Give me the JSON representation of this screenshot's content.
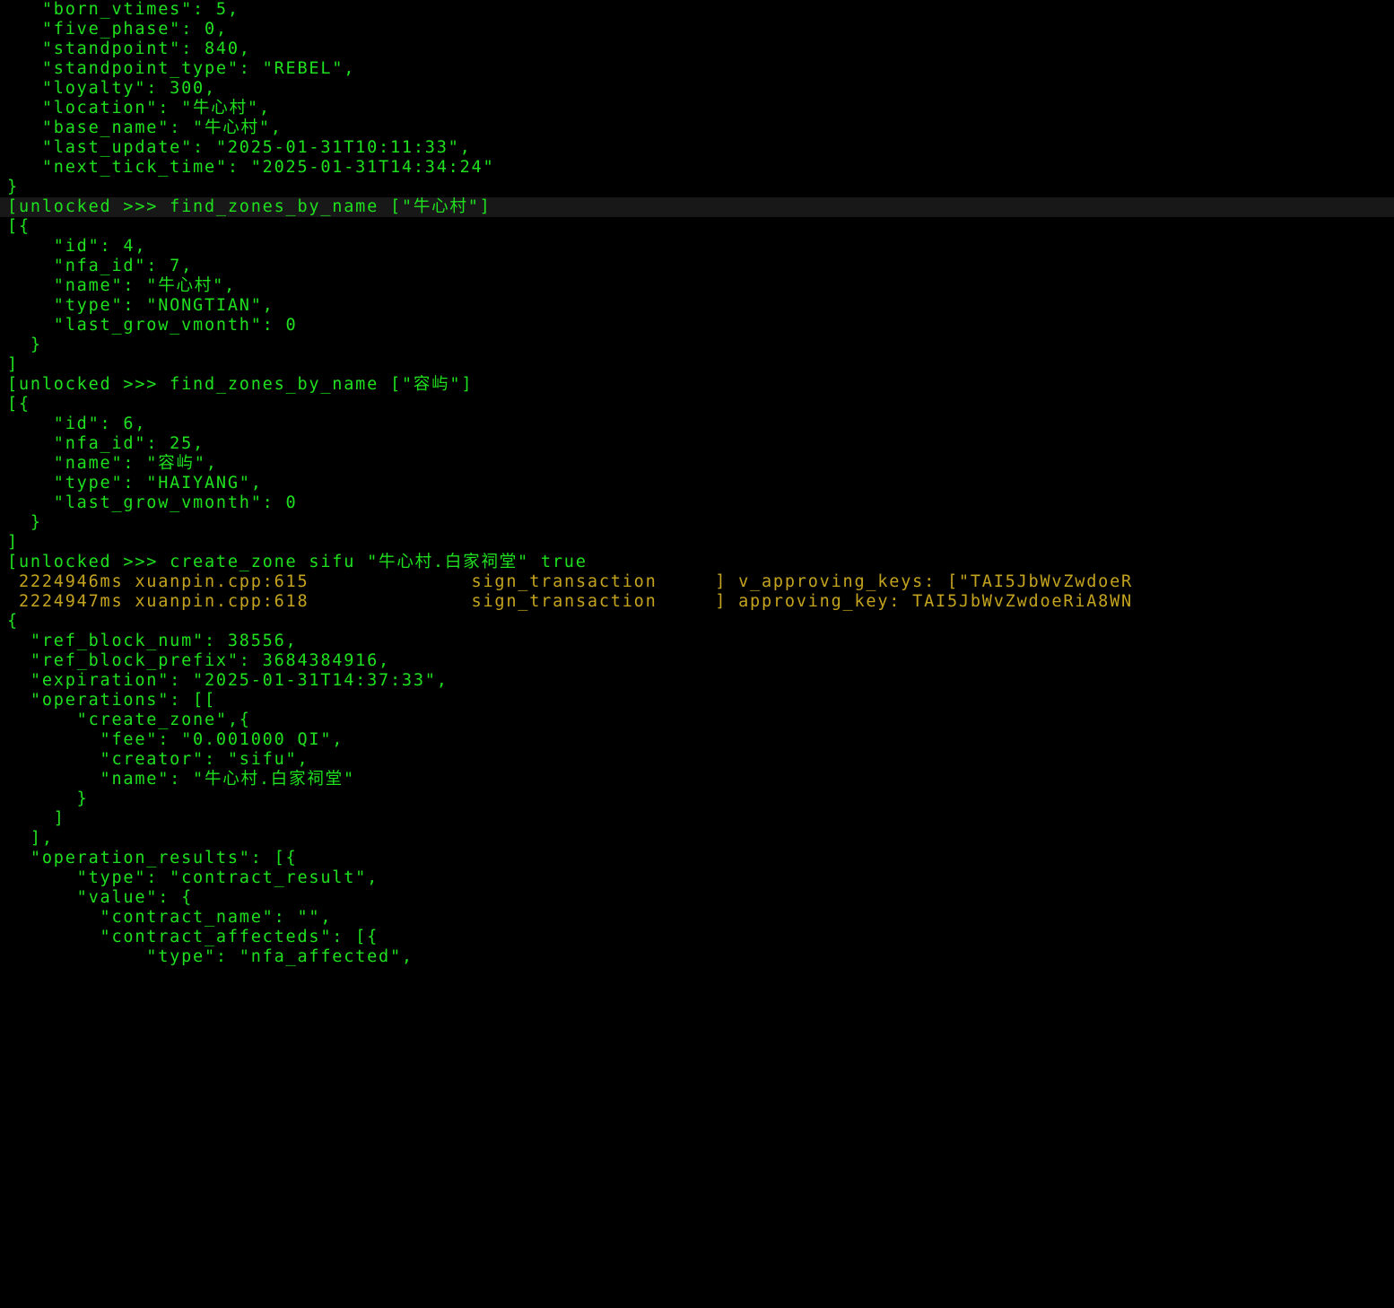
{
  "lines": [
    {
      "cls": "green",
      "text": "   \"born_vtimes\": 5,"
    },
    {
      "cls": "green",
      "text": "   \"five_phase\": 0,"
    },
    {
      "cls": "green",
      "text": "   \"standpoint\": 840,"
    },
    {
      "cls": "green",
      "text": "   \"standpoint_type\": \"REBEL\","
    },
    {
      "cls": "green",
      "text": "   \"loyalty\": 300,"
    },
    {
      "cls": "green",
      "text": "   \"location\": \"牛心村\","
    },
    {
      "cls": "green",
      "text": "   \"base_name\": \"牛心村\","
    },
    {
      "cls": "green",
      "text": "   \"last_update\": \"2025-01-31T10:11:33\","
    },
    {
      "cls": "green",
      "text": "   \"next_tick_time\": \"2025-01-31T14:34:24\""
    },
    {
      "cls": "green",
      "text": "}"
    },
    {
      "cls": "green hl",
      "text": "[unlocked >>> find_zones_by_name [\"牛心村\"]"
    },
    {
      "cls": "green",
      "text": "[{"
    },
    {
      "cls": "green",
      "text": "    \"id\": 4,"
    },
    {
      "cls": "green",
      "text": "    \"nfa_id\": 7,"
    },
    {
      "cls": "green",
      "text": "    \"name\": \"牛心村\","
    },
    {
      "cls": "green",
      "text": "    \"type\": \"NONGTIAN\","
    },
    {
      "cls": "green",
      "text": "    \"last_grow_vmonth\": 0"
    },
    {
      "cls": "green",
      "text": "  }"
    },
    {
      "cls": "green",
      "text": "]"
    },
    {
      "cls": "green",
      "text": "[unlocked >>> find_zones_by_name [\"容屿\"]"
    },
    {
      "cls": "green",
      "text": "[{"
    },
    {
      "cls": "green",
      "text": "    \"id\": 6,"
    },
    {
      "cls": "green",
      "text": "    \"nfa_id\": 25,"
    },
    {
      "cls": "green",
      "text": "    \"name\": \"容屿\","
    },
    {
      "cls": "green",
      "text": "    \"type\": \"HAIYANG\","
    },
    {
      "cls": "green",
      "text": "    \"last_grow_vmonth\": 0"
    },
    {
      "cls": "green",
      "text": "  }"
    },
    {
      "cls": "green",
      "text": "]"
    },
    {
      "cls": "green",
      "text": "[unlocked >>> create_zone sifu \"牛心村.白家祠堂\" true"
    },
    {
      "cls": "yellow",
      "text": " 2224946ms xuanpin.cpp:615              sign_transaction     ] v_approving_keys: [\"TAI5JbWvZwdoeR"
    },
    {
      "cls": "yellow",
      "text": " 2224947ms xuanpin.cpp:618              sign_transaction     ] approving_key: TAI5JbWvZwdoeRiA8WN"
    },
    {
      "cls": "green",
      "text": "{"
    },
    {
      "cls": "green",
      "text": "  \"ref_block_num\": 38556,"
    },
    {
      "cls": "green",
      "text": "  \"ref_block_prefix\": 3684384916,"
    },
    {
      "cls": "green",
      "text": "  \"expiration\": \"2025-01-31T14:37:33\","
    },
    {
      "cls": "green",
      "text": "  \"operations\": [["
    },
    {
      "cls": "green",
      "text": "      \"create_zone\",{"
    },
    {
      "cls": "green",
      "text": "        \"fee\": \"0.001000 QI\","
    },
    {
      "cls": "green",
      "text": "        \"creator\": \"sifu\","
    },
    {
      "cls": "green",
      "text": "        \"name\": \"牛心村.白家祠堂\""
    },
    {
      "cls": "green",
      "text": "      }"
    },
    {
      "cls": "green",
      "text": "    ]"
    },
    {
      "cls": "green",
      "text": "  ],"
    },
    {
      "cls": "green",
      "text": "  \"operation_results\": [{"
    },
    {
      "cls": "green",
      "text": "      \"type\": \"contract_result\","
    },
    {
      "cls": "green",
      "text": "      \"value\": {"
    },
    {
      "cls": "green",
      "text": "        \"contract_name\": \"\","
    },
    {
      "cls": "green",
      "text": "        \"contract_affecteds\": [{"
    },
    {
      "cls": "green",
      "text": "            \"type\": \"nfa_affected\","
    }
  ]
}
